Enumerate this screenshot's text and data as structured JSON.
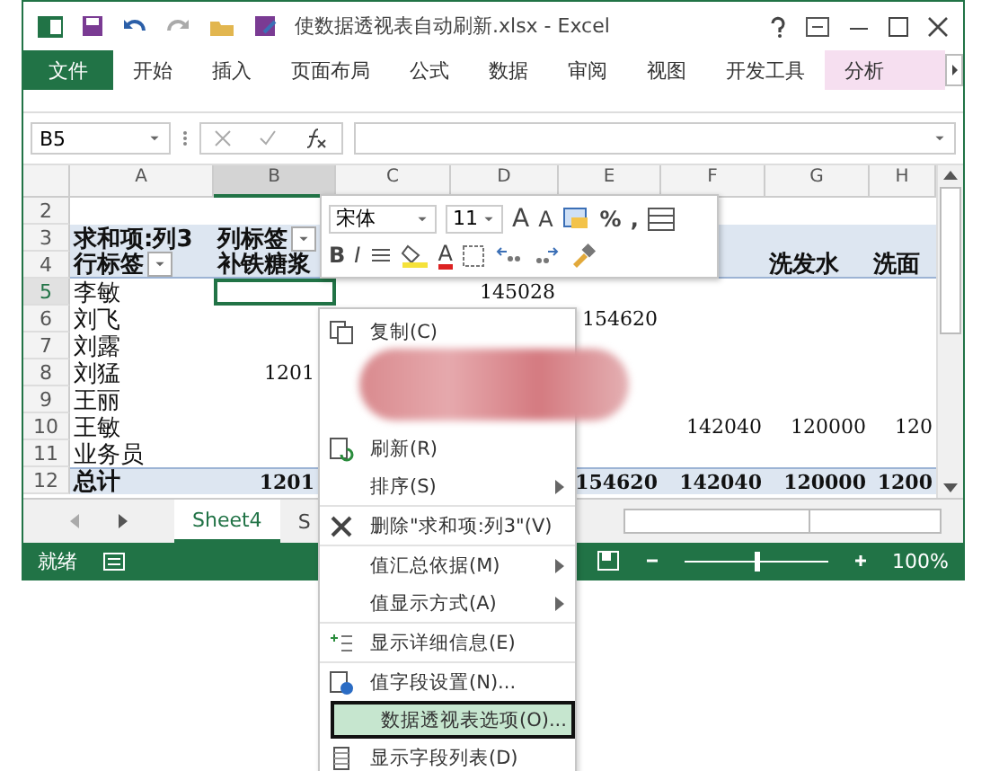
{
  "window": {
    "title": "使数据透视表自动刷新.xlsx - Excel"
  },
  "ribbon_tabs": [
    {
      "label": "文件",
      "kind": "file"
    },
    {
      "label": "开始",
      "kind": "tab"
    },
    {
      "label": "插入",
      "kind": "tab"
    },
    {
      "label": "页面布局",
      "kind": "tab"
    },
    {
      "label": "公式",
      "kind": "tab"
    },
    {
      "label": "数据",
      "kind": "tab"
    },
    {
      "label": "审阅",
      "kind": "tab"
    },
    {
      "label": "视图",
      "kind": "tab"
    },
    {
      "label": "开发工具",
      "kind": "tab"
    },
    {
      "label": "分析",
      "kind": "context"
    }
  ],
  "name_box": "B5",
  "columns": [
    {
      "label": "A",
      "selected": false
    },
    {
      "label": "B",
      "selected": true
    },
    {
      "label": "C",
      "selected": false
    },
    {
      "label": "D",
      "selected": false
    },
    {
      "label": "E",
      "selected": false
    },
    {
      "label": "F",
      "selected": false
    },
    {
      "label": "G",
      "selected": false
    },
    {
      "label": "H",
      "selected": false
    }
  ],
  "rows": [
    {
      "number": "2",
      "kind": "body",
      "cells": [
        {
          "kind": "empty"
        },
        {
          "kind": "empty"
        },
        {
          "kind": "empty"
        },
        {
          "kind": "empty"
        },
        {
          "kind": "empty"
        },
        {
          "kind": "empty"
        },
        {
          "kind": "empty"
        },
        {
          "kind": "empty"
        }
      ]
    },
    {
      "number": "3",
      "kind": "header",
      "cells": [
        {
          "kind": "text",
          "text": "求和项:列3"
        },
        {
          "kind": "text",
          "text": "列标签",
          "dropdown": true
        },
        {
          "kind": "empty"
        },
        {
          "kind": "empty"
        },
        {
          "kind": "empty"
        },
        {
          "kind": "empty"
        },
        {
          "kind": "empty"
        },
        {
          "kind": "empty"
        }
      ]
    },
    {
      "number": "4",
      "kind": "header",
      "cells": [
        {
          "kind": "text",
          "text": "行标签",
          "dropdown": true
        },
        {
          "kind": "text",
          "text": "补铁糖浆"
        },
        {
          "kind": "empty"
        },
        {
          "kind": "empty"
        },
        {
          "kind": "empty"
        },
        {
          "kind": "empty"
        },
        {
          "kind": "text",
          "text": "洗发水"
        },
        {
          "kind": "text",
          "text": "洗面"
        }
      ]
    },
    {
      "number": "5",
      "kind": "body",
      "cells": [
        {
          "kind": "text",
          "text": "李敏"
        },
        {
          "kind": "active"
        },
        {
          "kind": "empty"
        },
        {
          "kind": "text",
          "text": "145028"
        },
        {
          "kind": "empty"
        },
        {
          "kind": "empty"
        },
        {
          "kind": "empty"
        },
        {
          "kind": "empty"
        }
      ]
    },
    {
      "number": "6",
      "kind": "body",
      "cells": [
        {
          "kind": "text",
          "text": "刘飞"
        },
        {
          "kind": "empty"
        },
        {
          "kind": "empty"
        },
        {
          "kind": "empty"
        },
        {
          "kind": "text",
          "text": "154620"
        },
        {
          "kind": "empty"
        },
        {
          "kind": "empty"
        },
        {
          "kind": "empty"
        }
      ]
    },
    {
      "number": "7",
      "kind": "body",
      "cells": [
        {
          "kind": "text",
          "text": "刘露"
        },
        {
          "kind": "empty"
        },
        {
          "kind": "empty"
        },
        {
          "kind": "empty"
        },
        {
          "kind": "empty"
        },
        {
          "kind": "empty"
        },
        {
          "kind": "empty"
        },
        {
          "kind": "empty"
        }
      ]
    },
    {
      "number": "8",
      "kind": "body",
      "cells": [
        {
          "kind": "text",
          "text": "刘猛"
        },
        {
          "kind": "text",
          "text": "1201"
        },
        {
          "kind": "empty"
        },
        {
          "kind": "empty"
        },
        {
          "kind": "empty"
        },
        {
          "kind": "empty"
        },
        {
          "kind": "empty"
        },
        {
          "kind": "empty"
        }
      ]
    },
    {
      "number": "9",
      "kind": "body",
      "cells": [
        {
          "kind": "text",
          "text": "王丽"
        },
        {
          "kind": "empty"
        },
        {
          "kind": "empty"
        },
        {
          "kind": "empty"
        },
        {
          "kind": "empty"
        },
        {
          "kind": "empty"
        },
        {
          "kind": "empty"
        },
        {
          "kind": "empty"
        }
      ]
    },
    {
      "number": "10",
      "kind": "body",
      "cells": [
        {
          "kind": "text",
          "text": "王敏"
        },
        {
          "kind": "empty"
        },
        {
          "kind": "empty"
        },
        {
          "kind": "empty"
        },
        {
          "kind": "empty"
        },
        {
          "kind": "text",
          "text": "142040"
        },
        {
          "kind": "text",
          "text": "120000"
        },
        {
          "kind": "text",
          "text": "120"
        }
      ]
    },
    {
      "number": "11",
      "kind": "body",
      "cells": [
        {
          "kind": "text",
          "text": "业务员"
        },
        {
          "kind": "empty"
        },
        {
          "kind": "empty"
        },
        {
          "kind": "empty"
        },
        {
          "kind": "empty"
        },
        {
          "kind": "empty"
        },
        {
          "kind": "empty"
        },
        {
          "kind": "empty"
        }
      ]
    },
    {
      "number": "12",
      "kind": "total",
      "cells": [
        {
          "kind": "text",
          "text": "总计"
        },
        {
          "kind": "text",
          "text": "1201"
        },
        {
          "kind": "empty"
        },
        {
          "kind": "empty"
        },
        {
          "kind": "text",
          "text": "154620"
        },
        {
          "kind": "text",
          "text": "142040"
        },
        {
          "kind": "text",
          "text": "120000"
        },
        {
          "kind": "text",
          "text": "1200"
        }
      ]
    }
  ],
  "sheet_tabs": [
    {
      "label": "Sheet4",
      "selected": true
    },
    {
      "label": "S",
      "selected": false
    }
  ],
  "status_bar": {
    "text": "就绪",
    "zoom": {
      "level": 0.5,
      "reading": "100%"
    }
  },
  "mini_toolbar": {
    "font": "宋体",
    "size": "11",
    "row1": [
      {
        "kind": "grow",
        "label": "A"
      },
      {
        "kind": "shrink",
        "label": "A"
      },
      {
        "kind": "format"
      },
      {
        "kind": "percent",
        "label": "%"
      },
      {
        "kind": "comma",
        "label": ","
      },
      {
        "kind": "table"
      }
    ],
    "row2": [
      {
        "kind": "bold",
        "label": "B"
      },
      {
        "kind": "italic",
        "label": "I"
      },
      {
        "kind": "align"
      },
      {
        "kind": "fill"
      },
      {
        "kind": "fontcolor",
        "label": "A"
      },
      {
        "kind": "border"
      },
      {
        "kind": "incdec"
      },
      {
        "kind": "decdec"
      },
      {
        "kind": "brush"
      }
    ]
  },
  "context_menu": [
    {
      "kind": "copy",
      "text": "复制(C)",
      "submenu": false,
      "separator": false,
      "selected": false
    },
    {
      "kind": "hidden"
    },
    {
      "kind": "refresh",
      "text": "刷新(R)",
      "submenu": false,
      "separator": false,
      "selected": false
    },
    {
      "kind": "plain",
      "text": "排序(S)",
      "submenu": true,
      "separator": false,
      "selected": false
    },
    {
      "kind": "delete",
      "text": "删除\"求和项:列3\"(V)",
      "submenu": false,
      "separator": true,
      "selected": false
    },
    {
      "kind": "plain",
      "text": "值汇总依据(M)",
      "submenu": true,
      "separator": true,
      "selected": false
    },
    {
      "kind": "plain",
      "text": "值显示方式(A)",
      "submenu": true,
      "separator": false,
      "selected": false
    },
    {
      "kind": "detail",
      "text": "显示详细信息(E)",
      "submenu": false,
      "separator": true,
      "selected": false
    },
    {
      "kind": "settings",
      "text": "值字段设置(N)...",
      "submenu": false,
      "separator": true,
      "selected": false
    },
    {
      "kind": "plain",
      "text": "数据透视表选项(O)...",
      "submenu": false,
      "separator": false,
      "selected": true
    },
    {
      "kind": "fieldlist",
      "text": "显示字段列表(D)",
      "submenu": false,
      "separator": false,
      "selected": false
    }
  ]
}
